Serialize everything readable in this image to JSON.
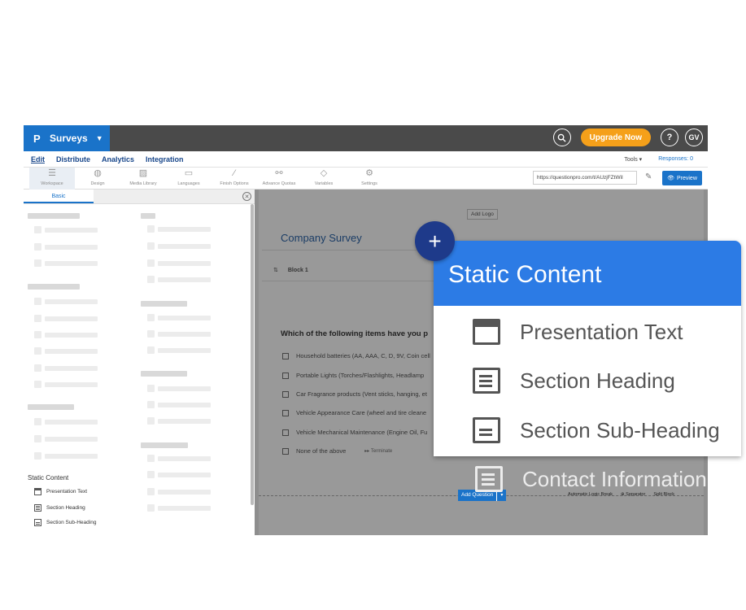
{
  "topbar": {
    "app_title": "Surveys",
    "upgrade_label": "Upgrade Now",
    "help_label": "?",
    "avatar_initials": "GV"
  },
  "menubar": {
    "items": [
      "Edit",
      "Distribute",
      "Analytics",
      "Integration"
    ],
    "tools_label": "Tools ▾",
    "responses_label": "Responses: 0"
  },
  "toolbar": {
    "tools": [
      {
        "label": "Workspace",
        "icon": "workspace-icon"
      },
      {
        "label": "Design",
        "icon": "palette-icon"
      },
      {
        "label": "Media Library",
        "icon": "image-icon"
      },
      {
        "label": "Languages",
        "icon": "language-icon"
      },
      {
        "label": "Finish Options",
        "icon": "wand-icon"
      },
      {
        "label": "Advance Quotas",
        "icon": "quota-icon"
      },
      {
        "label": "Variables",
        "icon": "tag-icon"
      },
      {
        "label": "Settings",
        "icon": "gear-icon"
      }
    ],
    "url": "https://questionpro.com/t/AUzjFZtWiI",
    "preview_label": "Preview"
  },
  "left_panel": {
    "tab_basic": "Basic",
    "static_content_heading": "Static Content",
    "static_items": [
      "Presentation Text",
      "Section Heading",
      "Section Sub-Heading"
    ]
  },
  "canvas": {
    "add_logo": "Add Logo",
    "survey_title": "Company Survey",
    "block_label": "Block 1",
    "question": "Which of the following items have you p",
    "options": [
      "Household batteries (AA, AAA, C, D, 9V, Coin cell",
      "Portable Lights (Torches/Flashlights, Headlamp",
      "Car Fragrance products (Vent sticks, hanging, et",
      "Vehicle Appearance Care (wheel and tire cleane",
      "Vehicle Mechanical Maintenance (Engine Oil, Fu",
      "None of the above"
    ],
    "terminate_label": "Terminate",
    "add_question_label": "Add Question",
    "footer_links": [
      "Automatic Logic Break",
      "Separator",
      "Split Block"
    ]
  },
  "popup": {
    "heading": "Static Content",
    "items": [
      "Presentation Text",
      "Section Heading",
      "Section Sub-Heading"
    ],
    "faded_item": "Contact Information"
  },
  "colors": {
    "brand_blue": "#1a73c9",
    "popup_blue": "#2c7be5",
    "fab_navy": "#1e3a8a",
    "upgrade_orange": "#f5a01a"
  }
}
